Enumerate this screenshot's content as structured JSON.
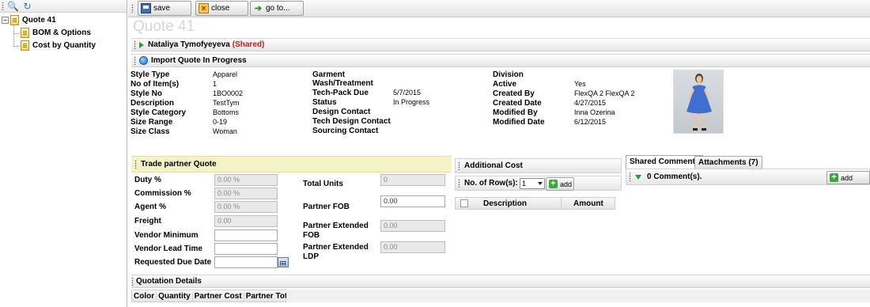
{
  "tree": {
    "root": "Quote 41",
    "children": [
      "BOM & Options",
      "Cost by Quantity"
    ]
  },
  "toolbar": {
    "save": "save",
    "close": "close",
    "goto": "go to..."
  },
  "page_title": "Quote 41",
  "owner_bar": {
    "name": "Nataliya Tymofyeyeva",
    "shared": "(Shared)"
  },
  "status_bar": {
    "label": "Import Quote In Progress"
  },
  "details": {
    "col1": [
      {
        "label": "Style Type",
        "value": "Apparel"
      },
      {
        "label": "No of Item(s)",
        "value": "1"
      },
      {
        "label": "Style No",
        "value": "1BO0002"
      },
      {
        "label": "Description",
        "value": "TestTym"
      },
      {
        "label": "Style Category",
        "value": "Bottoms"
      },
      {
        "label": "Size Range",
        "value": "0-19"
      },
      {
        "label": "Size Class",
        "value": "Woman"
      }
    ],
    "col2": [
      {
        "label": "Garment",
        "value": ""
      },
      {
        "label": "Wash/Treatment",
        "value": ""
      },
      {
        "label": "Tech-Pack Due",
        "value": "5/7/2015"
      },
      {
        "label": "Status",
        "value": "In Progress"
      },
      {
        "label": "Design Contact",
        "value": ""
      },
      {
        "label": "Tech Design Contact",
        "value": ""
      },
      {
        "label": "Sourcing Contact",
        "value": ""
      }
    ],
    "col3": [
      {
        "label": "Division",
        "value": ""
      },
      {
        "label": "Active",
        "value": "Yes"
      },
      {
        "label": "Created By",
        "value": "FlexQA 2 FlexQA 2"
      },
      {
        "label": "Created Date",
        "value": "4/27/2015"
      },
      {
        "label": "Modified By",
        "value": "Inna Ozerina"
      },
      {
        "label": "Modified Date",
        "value": "6/12/2015"
      }
    ]
  },
  "trade_partner": {
    "title": "Trade partner Quote",
    "left_fields": [
      {
        "label": "Duty %",
        "value": "0.00 %",
        "readonly": true
      },
      {
        "label": "Commission %",
        "value": "0.00 %",
        "readonly": true
      },
      {
        "label": "Agent %",
        "value": "0.00 %",
        "readonly": true
      },
      {
        "label": "Freight",
        "value": "0.00",
        "readonly": true
      },
      {
        "label": "Vendor Minimum",
        "value": "",
        "readonly": false
      },
      {
        "label": "Vendor Lead Time",
        "value": "",
        "readonly": false
      },
      {
        "label": "Requested Due Date",
        "value": "",
        "readonly": false
      }
    ],
    "right_fields": [
      {
        "label": "Total Units",
        "value": "0",
        "readonly": true
      },
      {
        "label": "Partner FOB",
        "value": "0.00",
        "readonly": false
      },
      {
        "label": "Partner Extended FOB",
        "value": "0.00",
        "readonly": true
      },
      {
        "label": "Partner Extended LDP",
        "value": "0.00",
        "readonly": true
      }
    ]
  },
  "additional_cost": {
    "title": "Additional Cost",
    "rows_label": "No. of Row(s):",
    "rows_value": "1",
    "add": "add",
    "columns": [
      "Description",
      "Amount"
    ]
  },
  "comments": {
    "tabs": [
      "Shared Comments",
      "Attachments (7)"
    ],
    "count_text": "0 Comment(s).",
    "add": "add"
  },
  "quotation_details": {
    "title": "Quotation Details",
    "columns": [
      "Color",
      "Quantity",
      "Partner Cost",
      "Partner Total"
    ]
  }
}
